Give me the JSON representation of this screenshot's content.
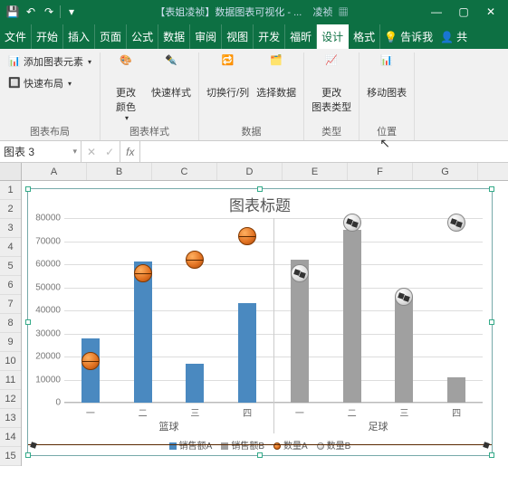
{
  "titlebar": {
    "doc_title": "【表姐凌祯】数据图表可视化 - ...",
    "user": "凌祯"
  },
  "tabs": {
    "items": [
      "文件",
      "开始",
      "插入",
      "页面",
      "公式",
      "数据",
      "审阅",
      "视图",
      "开发",
      "福昕",
      "设计",
      "格式"
    ],
    "active_index": 10,
    "tell_me": "告诉我",
    "share": "共"
  },
  "ribbon": {
    "g0": {
      "btn1": "添加图表元素",
      "btn2": "快速布局",
      "label": "图表布局"
    },
    "g1": {
      "btn1": "更改\n颜色",
      "btn2": "快速样式",
      "label": "图表样式"
    },
    "g2": {
      "btn1": "切换行/列",
      "btn2": "选择数据",
      "label": "数据"
    },
    "g3": {
      "btn1": "更改\n图表类型",
      "label": "类型"
    },
    "g4": {
      "btn1": "移动图表",
      "label": "位置"
    }
  },
  "namebox": {
    "value": "图表 3",
    "fx": "fx"
  },
  "sheet": {
    "cols": [
      "A",
      "B",
      "C",
      "D",
      "E",
      "F",
      "G"
    ],
    "rows": [
      "1",
      "2",
      "3",
      "4",
      "5",
      "6",
      "7",
      "8",
      "9",
      "10",
      "11",
      "12",
      "13",
      "14",
      "15"
    ]
  },
  "chart_data": {
    "type": "bar",
    "title": "图表标题",
    "ylim": [
      0,
      80000
    ],
    "yticks": [
      0,
      10000,
      20000,
      30000,
      40000,
      50000,
      60000,
      70000,
      80000
    ],
    "groups": [
      "篮球",
      "足球"
    ],
    "categories": [
      "一",
      "二",
      "三",
      "四"
    ],
    "series": [
      {
        "name": "销售额A",
        "color": "#4a89c0",
        "group": "篮球",
        "values": [
          28000,
          61000,
          17000,
          43000
        ]
      },
      {
        "name": "销售额B",
        "color": "#a0a0a0",
        "group": "足球",
        "values": [
          62000,
          75000,
          46000,
          11000
        ]
      },
      {
        "name": "数量A",
        "marker": "bball",
        "group": "篮球",
        "values": [
          18000,
          56000,
          62000,
          72000
        ]
      },
      {
        "name": "数量B",
        "marker": "sball",
        "group": "足球",
        "values": [
          56000,
          78000,
          46000,
          78000
        ]
      }
    ],
    "legend": [
      "销售额A",
      "销售额B",
      "数量A",
      "数量B"
    ]
  }
}
